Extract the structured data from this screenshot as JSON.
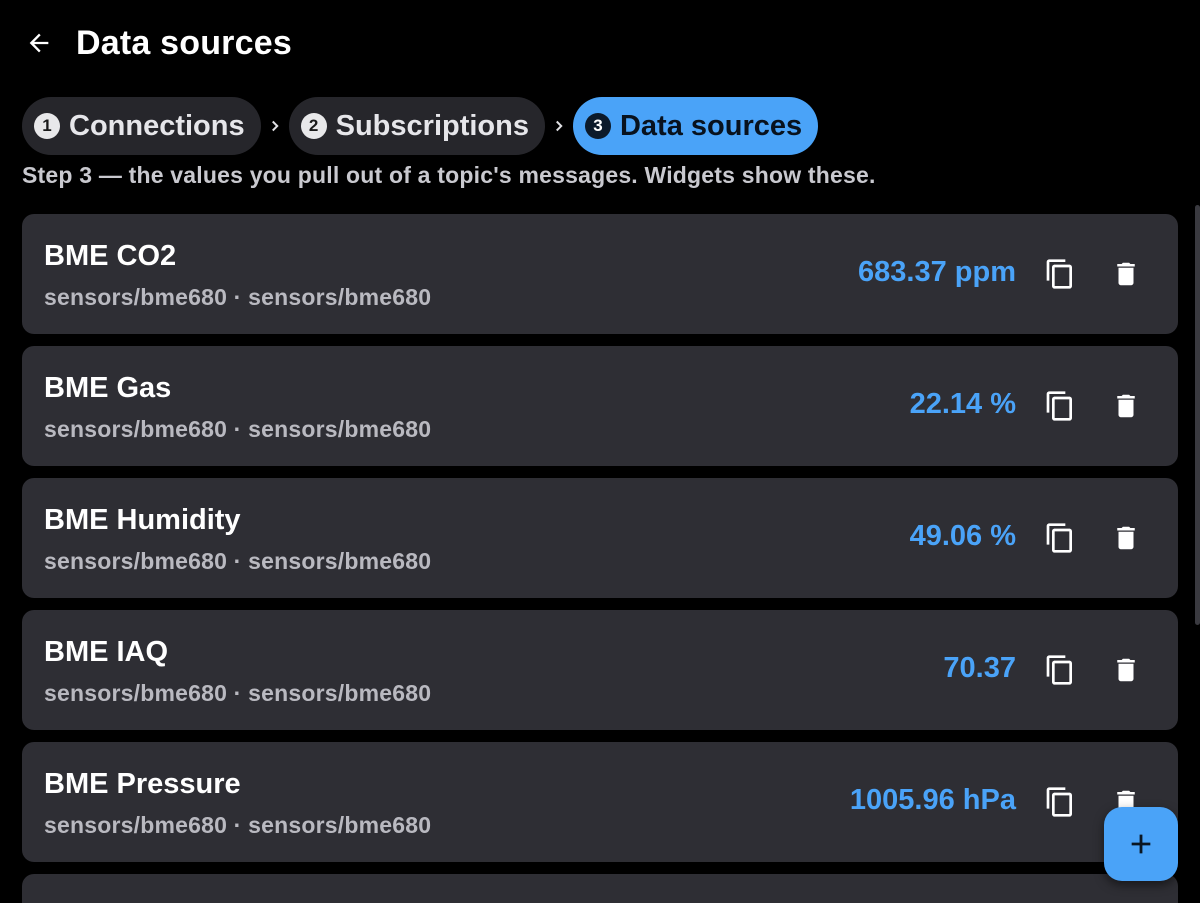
{
  "header": {
    "title": "Data sources"
  },
  "stepper": {
    "steps": [
      {
        "num": "1",
        "label": "Connections",
        "active": false
      },
      {
        "num": "2",
        "label": "Subscriptions",
        "active": false
      },
      {
        "num": "3",
        "label": "Data sources",
        "active": true
      }
    ]
  },
  "helper_text": "Step 3 — the values you pull out of a topic's messages. Widgets show these.",
  "colors": {
    "accent": "#4aa3f8",
    "card": "#2e2e34",
    "background": "#000000"
  },
  "sources": [
    {
      "name": "BME CO2",
      "topic": "sensors/bme680 · sensors/bme680",
      "value": "683.37 ppm"
    },
    {
      "name": "BME Gas",
      "topic": "sensors/bme680 · sensors/bme680",
      "value": "22.14 %"
    },
    {
      "name": "BME Humidity",
      "topic": "sensors/bme680 · sensors/bme680",
      "value": "49.06 %"
    },
    {
      "name": "BME IAQ",
      "topic": "sensors/bme680 · sensors/bme680",
      "value": "70.37"
    },
    {
      "name": "BME Pressure",
      "topic": "sensors/bme680 · sensors/bme680",
      "value": "1005.96 hPa"
    }
  ],
  "icons": {
    "back": "arrow-left-icon",
    "copy": "copy-icon",
    "delete": "trash-icon",
    "add": "plus-icon"
  }
}
